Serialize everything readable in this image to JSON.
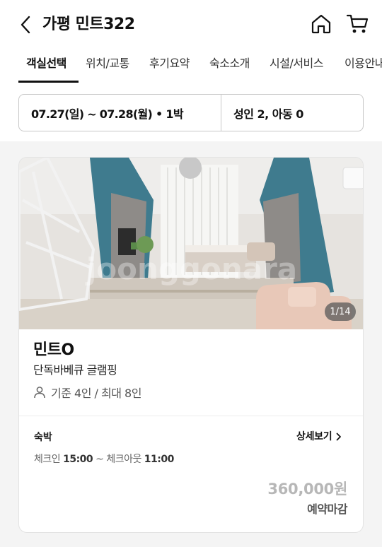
{
  "header": {
    "title": "가평 민트322",
    "back_icon": "chevron-left-icon",
    "home_icon": "home-icon",
    "cart_icon": "cart-icon"
  },
  "tabs": [
    {
      "label": "객실선택",
      "active": true
    },
    {
      "label": "위치/교통",
      "active": false
    },
    {
      "label": "후기요약",
      "active": false
    },
    {
      "label": "숙소소개",
      "active": false
    },
    {
      "label": "시설/서비스",
      "active": false
    },
    {
      "label": "이용안내",
      "active": false
    }
  ],
  "search": {
    "dates": "07.27(일) ~ 07.28(월) • 1박",
    "guests": "성인 2, 아동 0"
  },
  "room": {
    "photo_counter": "1/14",
    "watermark": "joonggonara",
    "name": "민트O",
    "subtitle": "단독바베큐 글램핑",
    "capacity": "기준 4인 / 최대 8인",
    "capacity_icon": "person-icon",
    "stay_type": "숙박",
    "detail_link": "상세보기",
    "checkin_label": "체크인",
    "checkin_time": "15:00",
    "separator": "~",
    "checkout_label": "체크아웃",
    "checkout_time": "11:00",
    "price": "360,000원",
    "status": "예약마감"
  },
  "colors": {
    "accent_teal": "#3f7b8e",
    "price_disabled": "#b7b7b7",
    "background": "#f4f4f4"
  }
}
